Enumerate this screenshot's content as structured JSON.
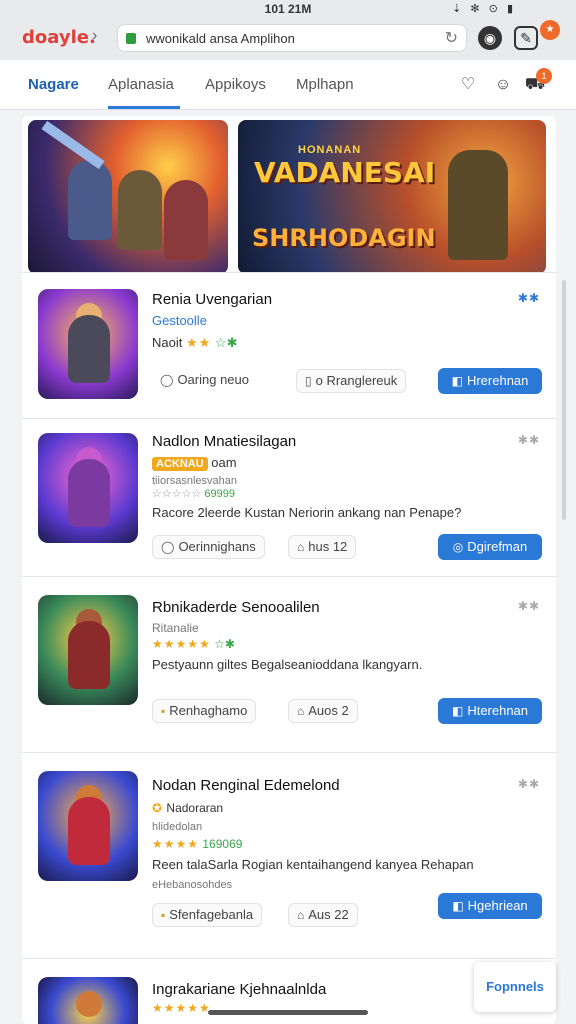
{
  "status": {
    "time": "101 21M",
    "icons": "⇣ ✻ ⊙ ▮"
  },
  "browser": {
    "brand_a": "doayle.",
    "brand_b": "",
    "url": "wwonikald ansa Amplihon",
    "badge": "★"
  },
  "tabs": [
    {
      "label": "Nagare",
      "active": true
    },
    {
      "label": "Aplanasia",
      "active": false
    },
    {
      "label": "Appikoys",
      "active": false
    },
    {
      "label": "Mplhapn",
      "active": false
    }
  ],
  "header_badge": "1",
  "banners": {
    "b2_sub": "HONANAN",
    "b2_title": "VADANESAI",
    "b2_title2": "SHRHODAGIN"
  },
  "games": [
    {
      "title": "Renia Uvengarian",
      "sub": "Gestoolle",
      "line": "Naoit",
      "stars": "★★",
      "stars_g": "☆✱",
      "corner": "✱✱",
      "pill1_icon": "◯",
      "pill1": "Oaring neuo",
      "pill2_icon": "▯",
      "pill2": "o Rranglereuk",
      "action_icon": "◧",
      "action": "Hrerehnan"
    },
    {
      "title": "Nadlon Mnatiesilagan",
      "badge": "ACKNAU",
      "badge_tail": "oam",
      "small": "tiiorsasnlesvahan",
      "stars": "☆☆☆☆☆",
      "stars_g": "69999",
      "desc": "Racore 2leerde Kustan Neriorin ankang nan Penape?",
      "corner": "✱✱",
      "pill1_icon": "◯",
      "pill1": "Oerinnighans",
      "pill2_icon": "⌂",
      "pill2": "hus 12",
      "action_icon": "◎",
      "action": "Dgirefman"
    },
    {
      "title": "Rbnikaderde Senooalilen",
      "sub": "Ritanalie",
      "stars": "★★★★★",
      "stars_g": "☆✱",
      "desc": "Pestyaunn giltes Begalseanioddana lkangyarn.",
      "corner": "✱✱",
      "pill1_icon": "▪",
      "pill1": "Renhaghamo",
      "pill2_icon": "⌂",
      "pill2": "Auos 2",
      "action_icon": "◧",
      "action": "Hterehnan"
    },
    {
      "title": "Nodan Renginal Edemelond",
      "sub": "Nadoraran",
      "small": "hlidedolan",
      "stars": "★★★★",
      "stars_g": "169069",
      "desc": "Reen talaSarla Rogian kentaihangend kanyea Rehapan",
      "small2": "eHebanosohdes",
      "corner": "✱✱",
      "pill1_icon": "▪",
      "pill1": "Sfenfagebanla",
      "pill2_icon": "⌂",
      "pill2": "Aus 22",
      "action_icon": "◧",
      "action": "Hgehriean"
    },
    {
      "title": "Ingrakariane Kjehnaalnlda",
      "stars": "★★★★★"
    }
  ],
  "float_button": "Fopnnels"
}
